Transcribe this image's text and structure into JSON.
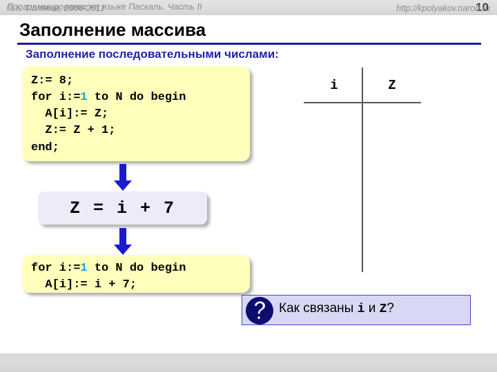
{
  "header": {
    "course_title": "Программирование на языке Паскаль. Часть II",
    "slide_number": "10"
  },
  "slide": {
    "title": "Заполнение массива",
    "subtitle": "Заполнение последовательными числами:",
    "rule_color": "#1b1b8f",
    "subtitle_color": "#2222aa"
  },
  "code_top": {
    "name": "pascal-fill-loop-verbose",
    "background": "#ffffbb",
    "accent_number_color": "#1a9fe0",
    "lines": [
      {
        "pre": "Z:= 8;",
        "num": "",
        "post": ""
      },
      {
        "pre": "for i:=",
        "num": "1",
        "post": " to N do begin"
      },
      {
        "pre": "  A[i]:= Z;",
        "num": "",
        "post": ""
      },
      {
        "pre": "  Z:= Z + 1;",
        "num": "",
        "post": ""
      },
      {
        "pre": "end;",
        "num": "",
        "post": ""
      }
    ]
  },
  "formula": {
    "text": "Z = i + 7",
    "background": "#ececf8"
  },
  "code_bottom": {
    "name": "pascal-fill-loop-compact",
    "background": "#ffffbb",
    "lines": [
      {
        "pre": "for i:=",
        "num": "1",
        "post": " to N do begin"
      },
      {
        "pre": "  A[i]:= i + 7;",
        "num": "",
        "post": ""
      }
    ]
  },
  "arrows": {
    "color": "#1a1acc",
    "count": 2
  },
  "table": {
    "columns": [
      "i",
      "Z"
    ],
    "rows": [],
    "line_color": "#555555"
  },
  "callout": {
    "icon": "question-mark-icon",
    "text_part1": "Как связаны ",
    "var1": "i",
    "text_part2": " и ",
    "var2": "Z",
    "text_part3": "?",
    "background": "#d8d8f4",
    "border_color": "#4646c8",
    "badge_color": "#0d0d70"
  },
  "footer": {
    "copyright": "© К. Поляков, 2006-2011",
    "url": "http://kpolyakov.narod.ru"
  }
}
